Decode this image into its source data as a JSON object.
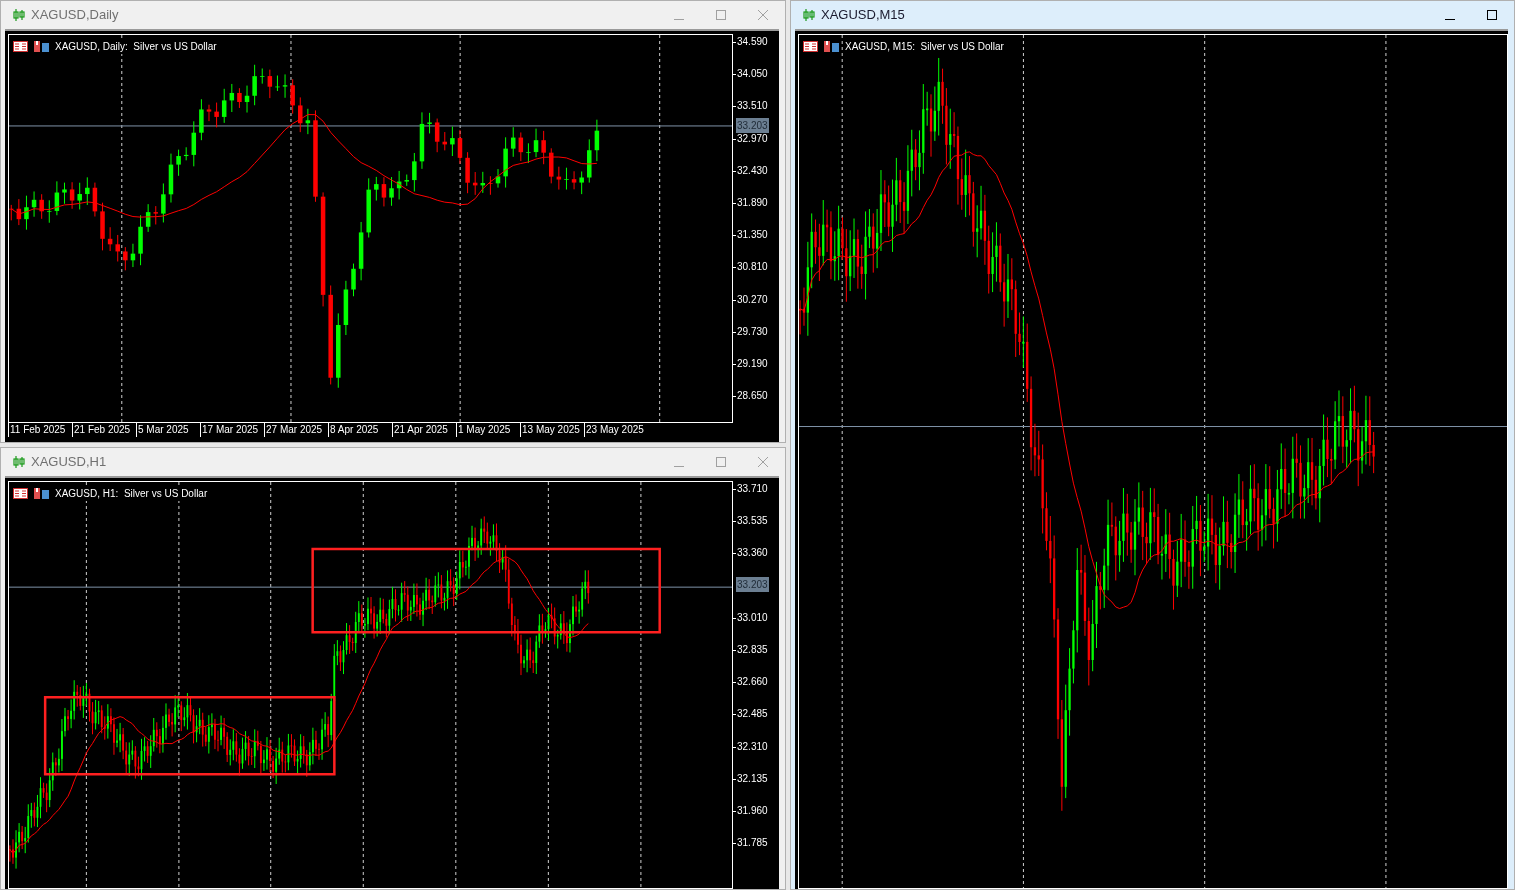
{
  "windows": [
    {
      "kind": "daily",
      "title": "XAGUSD,Daily",
      "active": false,
      "header": "XAGUSD, Daily:  Silver vs US Dollar",
      "current_price": "33.203",
      "window_buttons": [
        {
          "kind": "minimize"
        },
        {
          "kind": "maximize"
        },
        {
          "kind": "close"
        }
      ],
      "price_labels": [
        "34.590",
        "34.050",
        "33.510",
        "32.970",
        "32.430",
        "31.890",
        "31.350",
        "30.810",
        "30.270",
        "29.730",
        "29.190",
        "28.650"
      ],
      "date_labels": [
        "11 Feb 2025",
        "21 Feb 2025",
        "5 Mar 2025",
        "17 Mar 2025",
        "27 Mar 2025",
        "8 Apr 2025",
        "21 Apr 2025",
        "1 May 2025",
        "13 May 2025",
        "23 May 2025"
      ]
    },
    {
      "kind": "h1",
      "title": "XAGUSD,H1",
      "active": false,
      "header": "XAGUSD, H1:  Silver vs US Dollar",
      "current_price": "33.203",
      "window_buttons": [
        {
          "kind": "minimize"
        },
        {
          "kind": "maximize"
        },
        {
          "kind": "close"
        }
      ],
      "price_labels": [
        "33.710",
        "33.535",
        "33.360",
        "33.010",
        "32.835",
        "32.660",
        "32.485",
        "32.310",
        "32.135",
        "31.960",
        "31.785"
      ]
    },
    {
      "kind": "m15",
      "title": "XAGUSD,M15",
      "active": true,
      "header": "XAGUSD, M15:  Silver vs US Dollar",
      "window_buttons": [
        {
          "kind": "minimize"
        },
        {
          "kind": "maximize"
        }
      ]
    }
  ]
}
